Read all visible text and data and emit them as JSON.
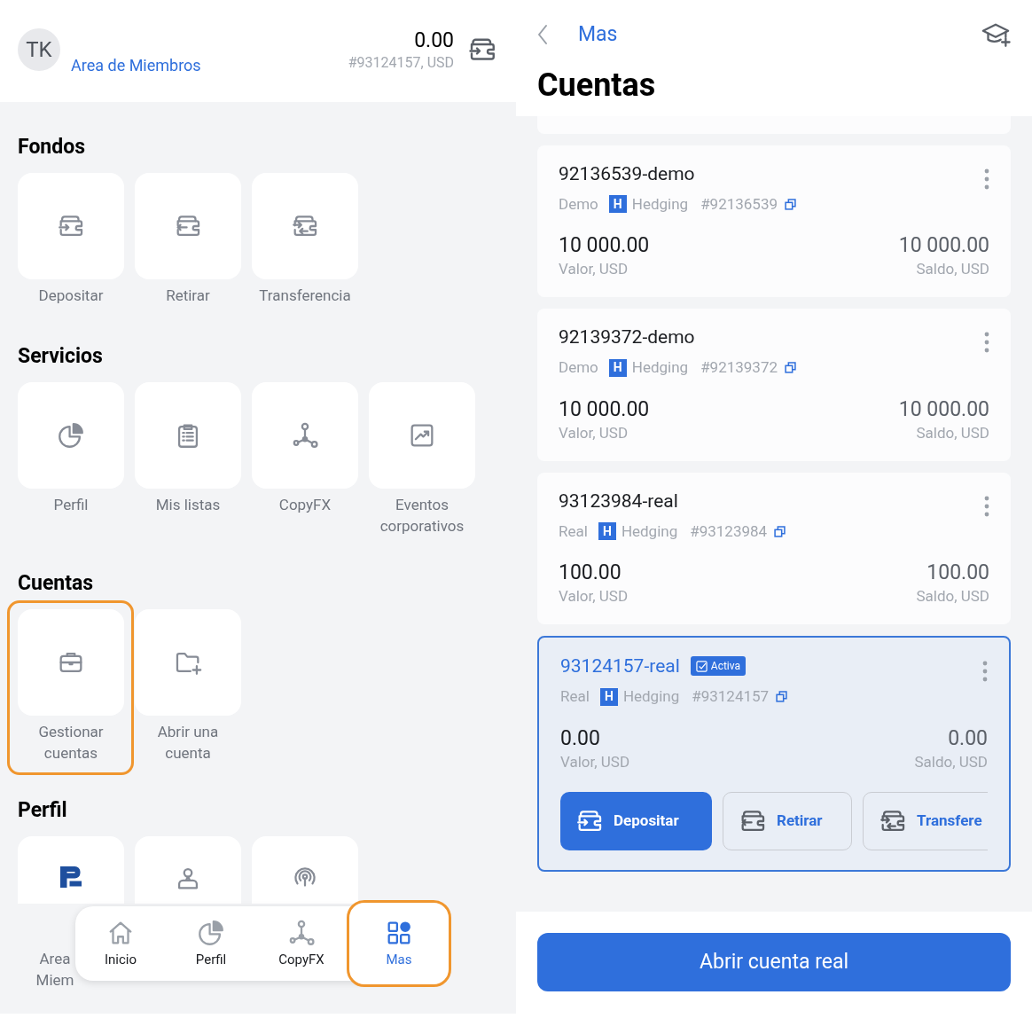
{
  "header": {
    "avatar": "TK",
    "link": "Area de Miembros",
    "balance": "0.00",
    "account": "#93124157, USD"
  },
  "sections": [
    {
      "title": "Fondos",
      "tiles": [
        {
          "kind": "deposit",
          "label": "Depositar"
        },
        {
          "kind": "withdraw",
          "label": "Retirar"
        },
        {
          "kind": "transfer",
          "label": "Transferencia"
        }
      ]
    },
    {
      "title": "Servicios",
      "tiles": [
        {
          "kind": "pie",
          "label": "Perfil"
        },
        {
          "kind": "list",
          "label": "Mis listas"
        },
        {
          "kind": "nodes",
          "label": "CopyFX"
        },
        {
          "kind": "chart",
          "label": "Eventos corporativos"
        }
      ]
    },
    {
      "title": "Cuentas",
      "tiles": [
        {
          "kind": "briefcase",
          "label": "Gestionar cuentas",
          "highlighted": true
        },
        {
          "kind": "folder",
          "label": "Abrir una cuenta"
        }
      ]
    },
    {
      "title": "Perfil",
      "tiles": [
        {
          "kind": "logo",
          "label": "Area Miem"
        },
        {
          "kind": "person"
        },
        {
          "kind": "signal"
        }
      ]
    }
  ],
  "bottom_nav": [
    {
      "kind": "home",
      "label": "Inicio",
      "selected": false
    },
    {
      "kind": "pie",
      "label": "Perfil",
      "selected": false
    },
    {
      "kind": "nodes",
      "label": "CopyFX",
      "selected": false
    },
    {
      "kind": "grid",
      "label": "Mas",
      "selected": true
    }
  ],
  "right_header": {
    "back": "Mas",
    "title": "Cuentas"
  },
  "accounts": [
    {
      "name": "92136539-demo",
      "type": "Demo",
      "mode_badge": "H",
      "mode": "Hedging",
      "number": "#92136539",
      "equity": "10 000.00",
      "equity_label": "Valor, USD",
      "balance": "10 000.00",
      "balance_label": "Saldo, USD",
      "active": false
    },
    {
      "name": "92139372-demo",
      "type": "Demo",
      "mode_badge": "H",
      "mode": "Hedging",
      "number": "#92139372",
      "equity": "10 000.00",
      "equity_label": "Valor, USD",
      "balance": "10 000.00",
      "balance_label": "Saldo, USD",
      "active": false
    },
    {
      "name": "93123984-real",
      "type": "Real",
      "mode_badge": "H",
      "mode": "Hedging",
      "number": "#93123984",
      "equity": "100.00",
      "equity_label": "Valor, USD",
      "balance": "100.00",
      "balance_label": "Saldo, USD",
      "active": false
    },
    {
      "name": "93124157-real",
      "badge": "Activa",
      "type": "Real",
      "mode_badge": "H",
      "mode": "Hedging",
      "number": "#93124157",
      "equity": "0.00",
      "equity_label": "Valor, USD",
      "balance": "0.00",
      "balance_label": "Saldo, USD",
      "active": true,
      "actions": [
        {
          "kind": "deposit",
          "label": "Depositar",
          "primary": true
        },
        {
          "kind": "withdraw",
          "label": "Retirar",
          "primary": false
        },
        {
          "kind": "transfer",
          "label": "Transfere",
          "primary": false
        }
      ]
    }
  ],
  "open_button": "Abrir cuenta real"
}
